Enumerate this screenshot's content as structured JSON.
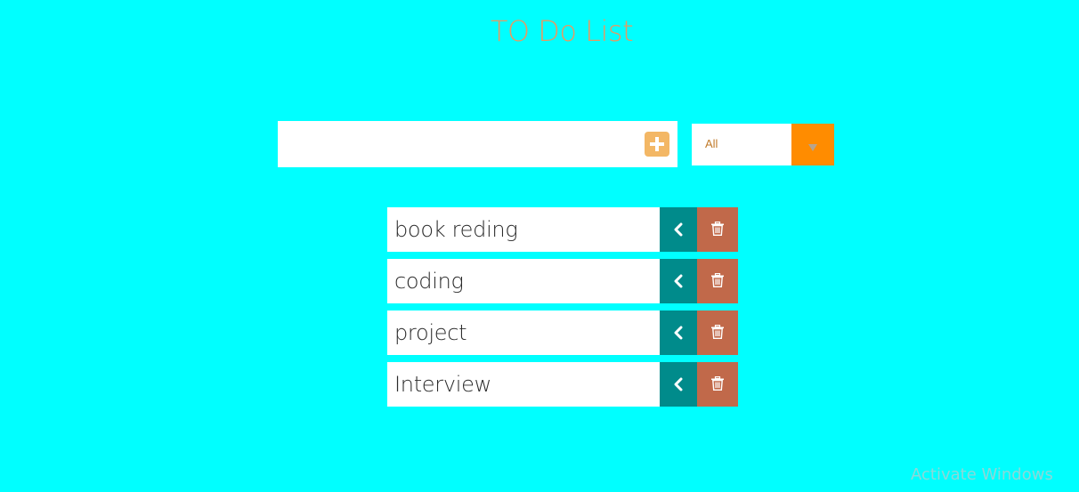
{
  "app": {
    "title": "TO Do List"
  },
  "input": {
    "value": "",
    "placeholder": ""
  },
  "filter": {
    "selected": "All"
  },
  "todos": [
    {
      "text": "book reding"
    },
    {
      "text": "coding"
    },
    {
      "text": "project"
    },
    {
      "text": "Interview"
    }
  ],
  "icons": {
    "add": "plus-square-icon",
    "dropdown": "caret-down-icon",
    "complete": "chevron-left-icon",
    "delete": "trash-icon"
  },
  "colors": {
    "background": "#00ffff",
    "title": "#e79a62",
    "add_button": "#f3b765",
    "filter_arrow": "#ff8c00",
    "complete_button": "#008b8b",
    "delete_button": "#c1694a"
  },
  "os_overlay": {
    "watermark": "Activate Windows"
  }
}
